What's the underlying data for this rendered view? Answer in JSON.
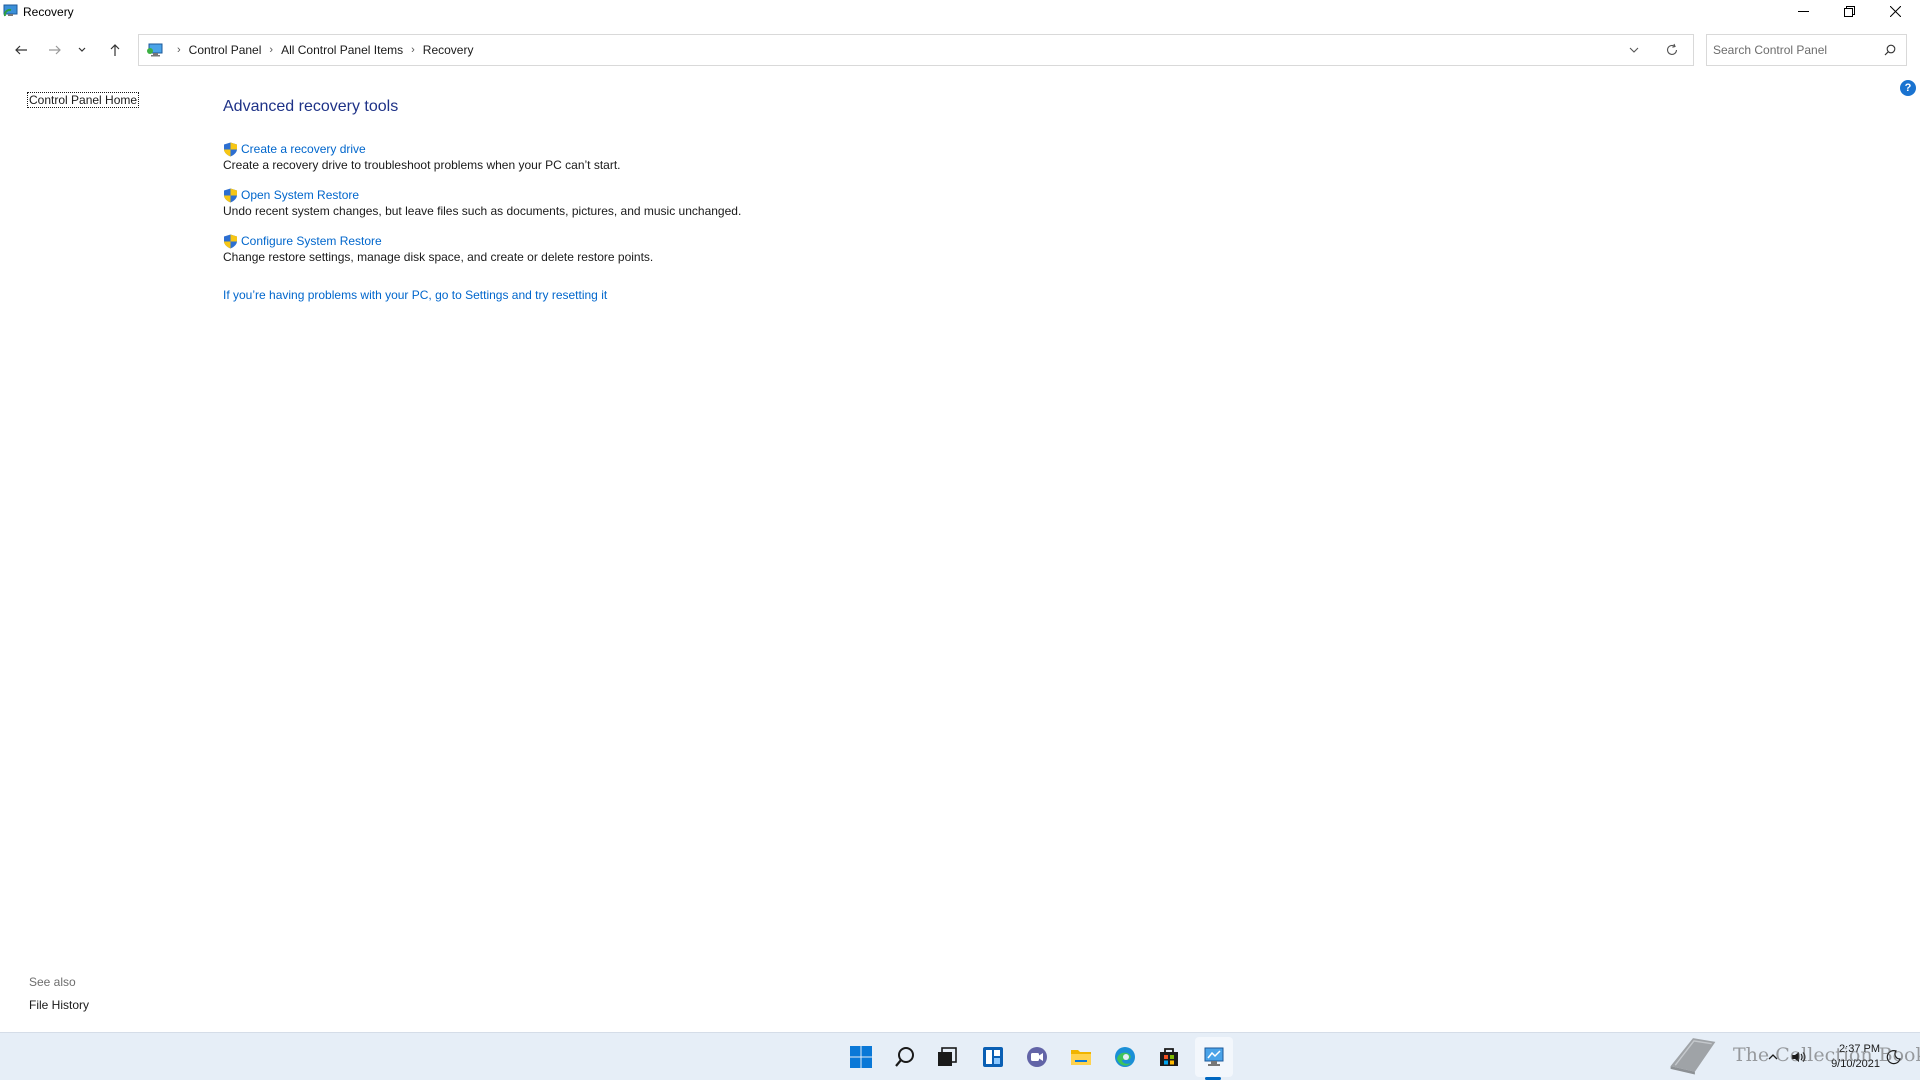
{
  "window": {
    "title": "Recovery"
  },
  "address": {
    "crumbs": [
      "Control Panel",
      "All Control Panel Items",
      "Recovery"
    ]
  },
  "search": {
    "placeholder": "Search Control Panel"
  },
  "left_pane": {
    "home_link": "Control Panel Home",
    "see_also_label": "See also",
    "see_also_items": [
      "File History"
    ]
  },
  "main": {
    "heading": "Advanced recovery tools",
    "items": [
      {
        "link": "Create a recovery drive",
        "desc": "Create a recovery drive to troubleshoot problems when your PC can’t start."
      },
      {
        "link": "Open System Restore",
        "desc": "Undo recent system changes, but leave files such as documents, pictures, and music unchanged."
      },
      {
        "link": "Configure System Restore",
        "desc": "Change restore settings, manage disk space, and create or delete restore points."
      }
    ],
    "reset_link": "If you’re having problems with your PC, go to Settings and try resetting it"
  },
  "help": {
    "glyph": "?"
  },
  "taskbar": {
    "icons": [
      "start-icon",
      "search-icon",
      "task-view-icon",
      "widgets-icon",
      "chat-icon",
      "file-explorer-icon",
      "edge-icon",
      "store-icon",
      "control-panel-icon"
    ],
    "time": "2:37 PM",
    "date": "9/10/2021"
  },
  "watermark": {
    "text": "The Collection Book"
  },
  "colors": {
    "link": "#0066cc",
    "heading": "#1e3287",
    "taskbar": "#e6eef7",
    "accent": "#0067c0"
  }
}
